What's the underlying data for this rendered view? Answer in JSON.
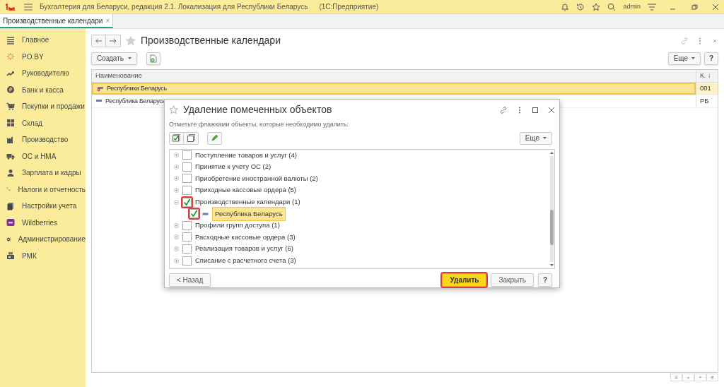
{
  "app_bar": {
    "title": "Бухгалтерия для Беларуси, редакция 2.1. Локализация для Республики Беларусь",
    "platform": "(1С:Предприятие)",
    "user": "admin"
  },
  "open_tabs": [
    {
      "label": "Производственные календари",
      "close": "×",
      "selected": true
    }
  ],
  "sidebar": {
    "items": [
      {
        "label": "Главное"
      },
      {
        "label": "PO.BY"
      },
      {
        "label": "Руководителю"
      },
      {
        "label": "Банк и касса"
      },
      {
        "label": "Покупки и продажи"
      },
      {
        "label": "Склад"
      },
      {
        "label": "Производство"
      },
      {
        "label": "ОС и НМА"
      },
      {
        "label": "Зарплата и кадры"
      },
      {
        "label": "Налоги и отчетность"
      },
      {
        "label": "Настройки учета"
      },
      {
        "label": "Wildberries"
      },
      {
        "label": "Администрирование"
      },
      {
        "label": "РМК"
      }
    ]
  },
  "form": {
    "title": "Производственные календари",
    "create_button": "Создать",
    "more_button": "Еще",
    "help_button": "?",
    "table": {
      "columns": [
        "Наименование",
        "К. ↓"
      ],
      "rows": [
        {
          "cells": [
            "Республика Беларусь",
            "001"
          ],
          "selected": true,
          "marked_for_deletion": true
        },
        {
          "cells": [
            "Республика Беларусь",
            "РБ"
          ],
          "selected": false,
          "marked_for_deletion": false
        }
      ]
    }
  },
  "dialog": {
    "title": "Удаление помеченных объектов",
    "hint": "Отметьте флажками объекты, которые необходимо удалить:",
    "more_button": "Еще",
    "tree": [
      {
        "label": "Поступление товаров и услуг (4)",
        "checked": false,
        "expanded": false,
        "highlighted": false,
        "selected": false
      },
      {
        "label": "Принятие к учету ОС (2)",
        "checked": false,
        "expanded": false,
        "highlighted": false,
        "selected": false
      },
      {
        "label": "Приобретение иностранной валюты (2)",
        "checked": false,
        "expanded": false,
        "highlighted": false,
        "selected": false
      },
      {
        "label": "Приходные кассовые ордера (5)",
        "checked": false,
        "expanded": false,
        "highlighted": false,
        "selected": false
      },
      {
        "label": "Производственные календари (1)",
        "checked": true,
        "expanded": true,
        "highlighted": true,
        "selected": false,
        "children": [
          {
            "label": "Республика Беларусь",
            "checked": true,
            "highlighted": true,
            "selected": true
          }
        ]
      },
      {
        "label": "Профили групп доступа (1)",
        "checked": false,
        "expanded": false,
        "highlighted": false,
        "selected": false
      },
      {
        "label": "Расходные кассовые ордера (3)",
        "checked": false,
        "expanded": false,
        "highlighted": false,
        "selected": false
      },
      {
        "label": "Реализация товаров и услуг (6)",
        "checked": false,
        "expanded": false,
        "highlighted": false,
        "selected": false
      },
      {
        "label": "Списание с расчетного счета (3)",
        "checked": false,
        "expanded": false,
        "highlighted": false,
        "selected": false
      }
    ],
    "buttons": [
      {
        "label": "< Назад",
        "kind": "secondary",
        "highlighted": false
      },
      {
        "label": "Удалить",
        "kind": "primary",
        "highlighted": true
      },
      {
        "label": "Закрыть",
        "kind": "secondary",
        "highlighted": false
      },
      {
        "label": "?",
        "kind": "help",
        "highlighted": false
      }
    ]
  }
}
